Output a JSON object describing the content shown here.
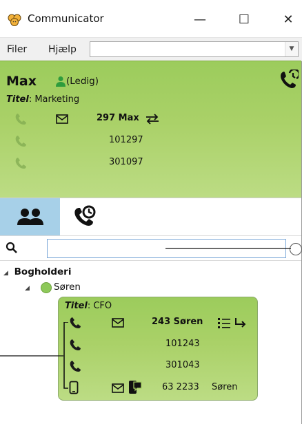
{
  "window": {
    "title": "Communicator"
  },
  "titlebar_buttons": {
    "minimize": "—",
    "maximize": "☐",
    "close": "✕"
  },
  "menu": {
    "items": [
      "Filer",
      "Hjælp"
    ],
    "combo_value": ""
  },
  "me": {
    "name": "Max",
    "status": "(Ledig)",
    "title_label": "Titel",
    "title_value": ": Marketing",
    "extension": "297 Max",
    "phones": [
      "101297",
      "301097"
    ]
  },
  "tabs": {
    "active": "contacts"
  },
  "search": {
    "value": "",
    "placeholder": ""
  },
  "tree": {
    "group": "Bogholderi",
    "contact": {
      "name": "Søren",
      "title_label": "Titel",
      "title_value": ": CFO",
      "extension": "243 Søren",
      "phones": [
        "101243",
        "301043"
      ],
      "mobile": "63 2233",
      "mobile_name": "Søren"
    }
  },
  "colors": {
    "panel_green": "#a8d065",
    "tab_active": "#a7d0e8",
    "input_border": "#7aa7d8"
  }
}
